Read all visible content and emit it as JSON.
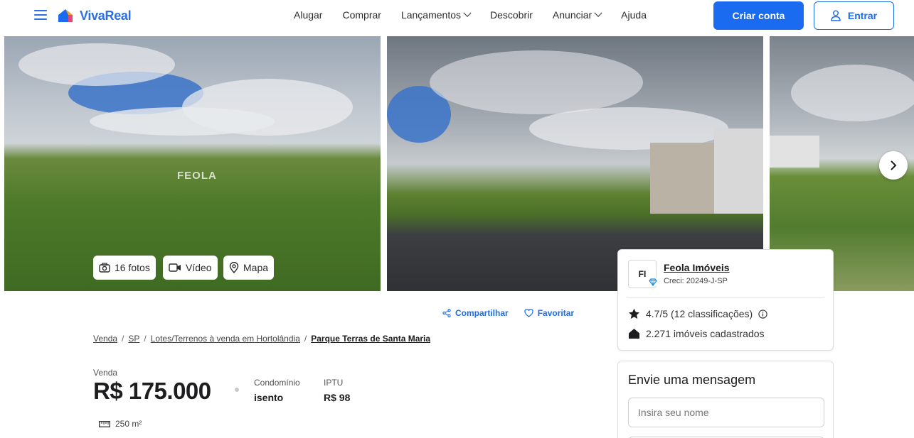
{
  "header": {
    "logo_text": "VivaReal",
    "nav": [
      {
        "label": "Alugar",
        "has_dropdown": false
      },
      {
        "label": "Comprar",
        "has_dropdown": false
      },
      {
        "label": "Lançamentos",
        "has_dropdown": true
      },
      {
        "label": "Descobrir",
        "has_dropdown": false
      },
      {
        "label": "Anunciar",
        "has_dropdown": true
      },
      {
        "label": "Ajuda",
        "has_dropdown": false
      }
    ],
    "create_account_label": "Criar conta",
    "login_label": "Entrar"
  },
  "gallery": {
    "watermark": "FEOLA",
    "photos_label": "16 fotos",
    "video_label": "Vídeo",
    "map_label": "Mapa"
  },
  "actions": {
    "share_label": "Compartilhar",
    "favorite_label": "Favoritar"
  },
  "breadcrumb": {
    "items": [
      "Venda",
      "SP",
      "Lotes/Terrenos à venda em Hortolândia"
    ],
    "current": "Parque Terras de Santa Maria"
  },
  "listing": {
    "price_label": "Venda",
    "price": "R$ 175.000",
    "condo_label": "Condomínio",
    "condo_value": "isento",
    "iptu_label": "IPTU",
    "iptu_value": "R$ 98",
    "area": "250 m²"
  },
  "advertiser": {
    "initials": "FI",
    "name": "Feola Imóveis",
    "creci": "Creci: 20249-J-SP",
    "rating": "4.7/5 (12 classificações)",
    "listings": "2.271 imóveis cadastrados"
  },
  "message_form": {
    "title": "Envie uma mensagem",
    "name_placeholder": "Insira seu nome"
  },
  "colors": {
    "brand": "#1a6bf0",
    "text": "#1d1d1f"
  }
}
